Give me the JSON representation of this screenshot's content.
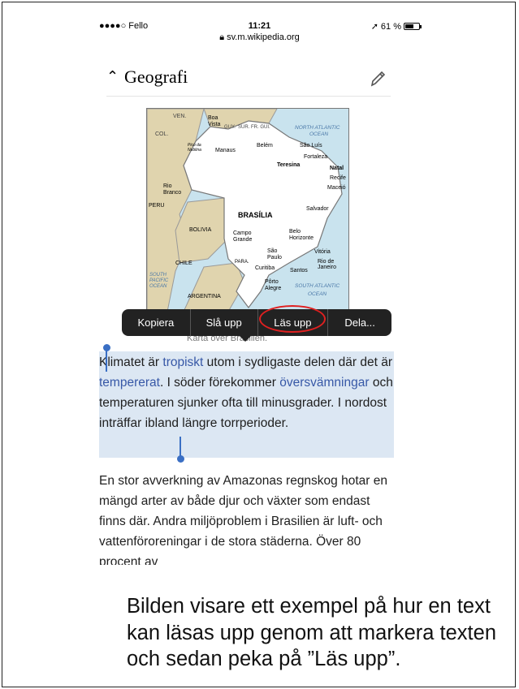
{
  "status_bar": {
    "carrier": "●●●●○ Fello",
    "time": "11:21",
    "battery_pct": "61 %",
    "battery_fraction": 0.61,
    "url": "sv.m.wikipedia.org"
  },
  "section": {
    "title": "Geografi"
  },
  "map": {
    "labels": [
      "VEN.",
      "GUY.",
      "SUR.",
      "FR. GUI.",
      "COL.",
      "NORTH ATLANTIC",
      "OCEAN",
      "Boa Vista",
      "Pico da Neblina",
      "Manaus",
      "Belém",
      "São Luís",
      "Fortaleza",
      "Teresina",
      "Natal",
      "Recife",
      "Maceió",
      "Rio Branco",
      "PERU",
      "BOLIVIA",
      "BRASÍLIA",
      "Salvador",
      "Campo Grande",
      "Belo Horizonte",
      "Vitória",
      "São Paulo",
      "Rio de Janeiro",
      "Santos",
      "Curitiba",
      "PARA.",
      "CHILE",
      "SOUTH PACIFIC OCEAN",
      "Pôrto Alegre",
      "SOUTH ATLANTIC",
      "OCEAN",
      "ARGENTINA"
    ],
    "caption": "Karta över Brasilien."
  },
  "edit_menu": {
    "items": [
      "Kopiera",
      "Slå upp",
      "Läs upp",
      "Dela..."
    ]
  },
  "article": {
    "p1": {
      "t1": "Klimatet är ",
      "l1": "tropiskt",
      "t2": " utom i sydligaste delen där det är ",
      "l2": "tempererat",
      "t3": ". I söder förekommer ",
      "l3": "översvämningar",
      "t4": " och temperaturen sjunker ofta till minusgrader. I nordost inträffar ibland längre torrperioder."
    },
    "p2": "En stor avverkning av Amazonas regnskog hotar en mängd arter av både djur och växter som endast finns där. Andra miljöproblem i Brasilien är luft- och vattenföroreningar i de stora städerna. Över 80 procent av"
  },
  "caption": "Bilden visare ett exempel på hur en text kan läsas upp genom att markera texten och sedan peka på ”Läs upp”."
}
